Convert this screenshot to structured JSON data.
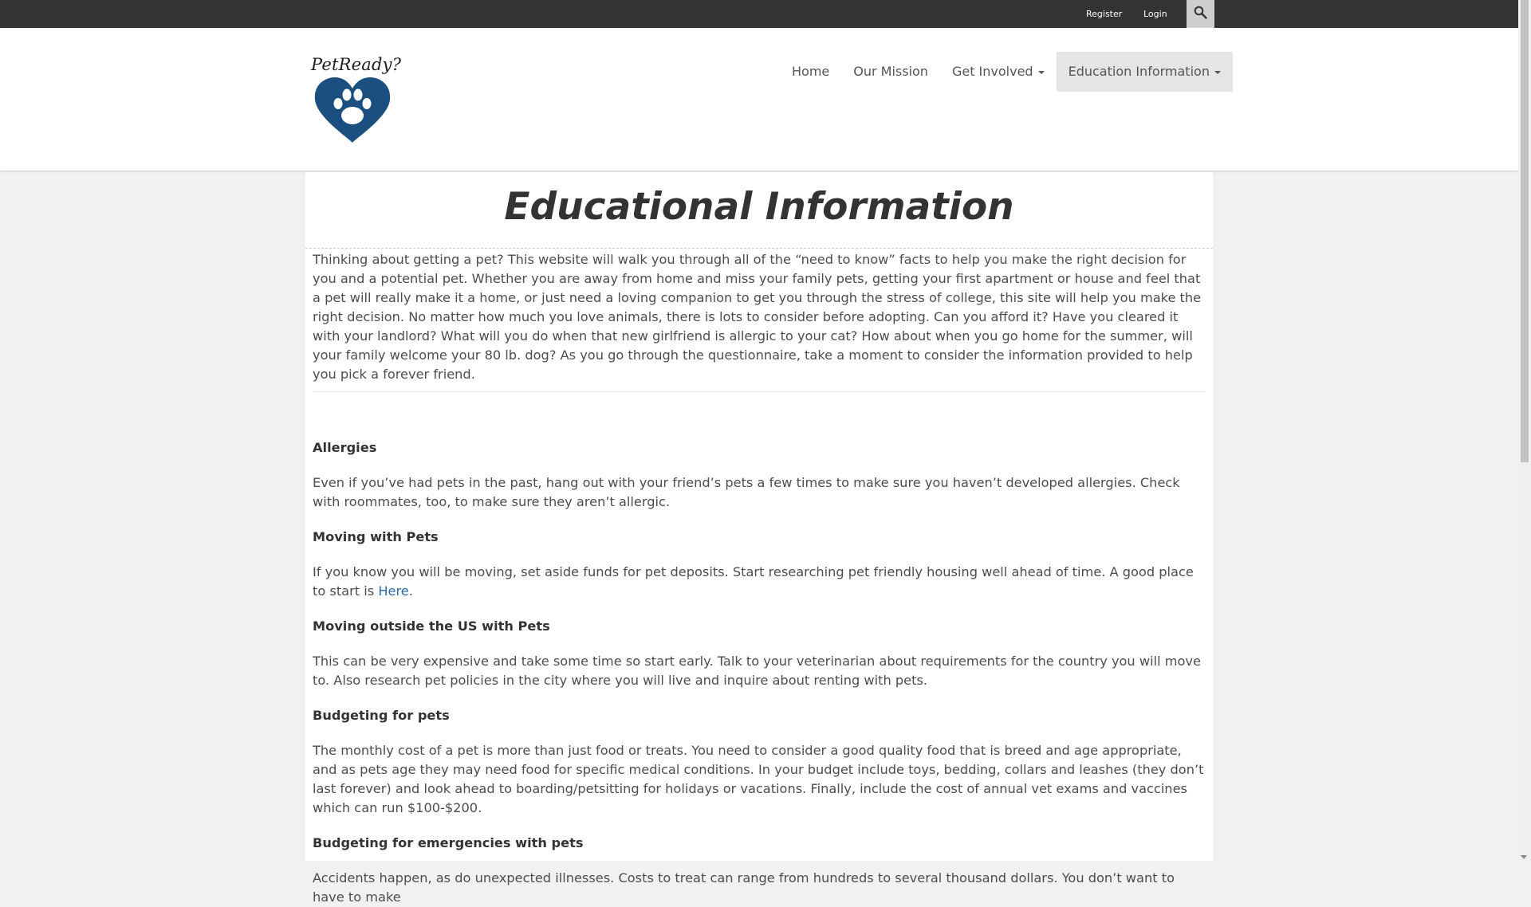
{
  "topbar": {
    "register_label": "Register",
    "login_label": "Login",
    "search_icon": "search-icon"
  },
  "brand": {
    "logo_text": "PetReady?",
    "logo_icon": "heart-paw-icon",
    "logo_color": "#1a4f80"
  },
  "nav": {
    "items": [
      {
        "label": "Home"
      },
      {
        "label": "Our Mission"
      },
      {
        "label": "Get Involved"
      },
      {
        "label": "Education Information"
      }
    ],
    "active_index": 3
  },
  "page": {
    "title": "Educational Information",
    "intro": "Thinking about getting a pet? This website will walk you through all of the “need to know” facts to help you make the right decision for you and a potential pet. Whether you are away from home and miss your family pets, getting your first apartment or house and feel that a pet will really make it a home, or just need a loving companion to get you through the stress of college, this site will help you make the right decision. No matter how much you love animals, there is lots to consider before adopting. Can you afford it? Have you cleared it with your landlord? What will you do when that new girlfriend is allergic to your cat? How about when you go home for the summer, will your family welcome your 80 lb. dog? As you go through the questionnaire, take a moment to consider the information provided to help you pick a forever friend.",
    "sections": [
      {
        "title": "Allergies",
        "text": "Even if you’ve had pets in the past, hang out with your friend’s pets a few times to make sure you haven’t developed allergies. Check with roommates, too, to make sure they aren’t allergic."
      },
      {
        "title": "Moving with Pets",
        "text": "If you know you will be moving, set aside funds for pet deposits. Start researching pet friendly housing well ahead of time. A good place to start is ",
        "link_label": "Here",
        "text_after": "."
      },
      {
        "title": "Moving outside the US with Pets",
        "text": "This can be very expensive and take some time so start early. Talk to your veterinarian about requirements for the country you will move to. Also research pet policies in the city where you will live and inquire about renting with pets."
      },
      {
        "title": "Budgeting for pets",
        "text": "The monthly cost of a pet is more than just food or treats. You need to consider a good quality food that is breed and age appropriate, and as pets age they may need food for specific medical conditions. In your budget include toys, bedding, collars and leashes (they don’t last forever) and look ahead to boarding/petsitting for holidays or vacations. Finally, include the cost of annual vet exams and vaccines which can run $100-$200."
      },
      {
        "title": "Budgeting for emergencies with pets",
        "text": "Accidents happen, as do unexpected illnesses. Costs to treat can range from hundreds to several thousand dollars. You don’t want to have to make"
      }
    ]
  },
  "colors": {
    "topbar_bg": "#333333",
    "page_bg": "#f1f1f1",
    "link": "#2a6aa8"
  }
}
